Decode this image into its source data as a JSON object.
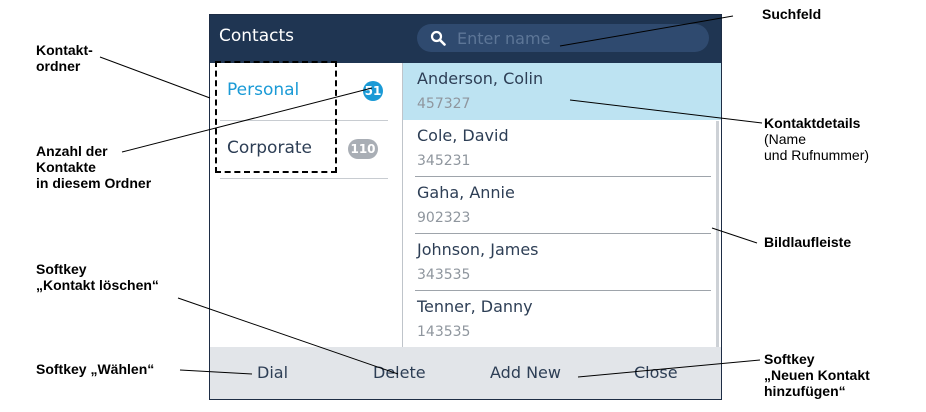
{
  "screen": {
    "title": "Contacts",
    "search_placeholder": "Enter name",
    "folders": [
      {
        "label": "Personal",
        "count": "51"
      },
      {
        "label": "Corporate",
        "count": "110"
      }
    ],
    "contacts": [
      {
        "name": "Anderson, Colin",
        "number": "457327"
      },
      {
        "name": "Cole, David",
        "number": "345231"
      },
      {
        "name": "Gaha, Annie",
        "number": "902323"
      },
      {
        "name": "Johnson, James",
        "number": "343535"
      },
      {
        "name": "Tenner, Danny",
        "number": "143535"
      }
    ],
    "softkeys": {
      "dial": "Dial",
      "delete": "Delete",
      "add_new": "Add New",
      "close": "Close"
    }
  },
  "annotations": {
    "suchfeld": "Suchfeld",
    "kontaktordner_1": "Kontakt-",
    "kontaktordner_2": "ordner",
    "kontaktdetails": "Kontaktdetails",
    "kontaktdetails_2": "(Name",
    "kontaktdetails_3": "und Rufnummer)",
    "anzahl_1": "Anzahl der",
    "anzahl_2": "Kontakte",
    "anzahl_3": "in diesem Ordner",
    "bildlaufleiste": "Bildlaufleiste",
    "softkey_loeschen_1": "Softkey",
    "softkey_loeschen_2": "„Kontakt löschen“",
    "softkey_waehlen": "Softkey „Wählen“",
    "softkey_neu_1": "Softkey",
    "softkey_neu_2": "„Neuen Kontakt",
    "softkey_neu_3": "hinzufügen“"
  },
  "colors": {
    "title_bar": "#1f3552",
    "accent": "#1a9ad6",
    "selected_row": "#bde3f2",
    "softkey_bar": "#e2e5e9"
  }
}
